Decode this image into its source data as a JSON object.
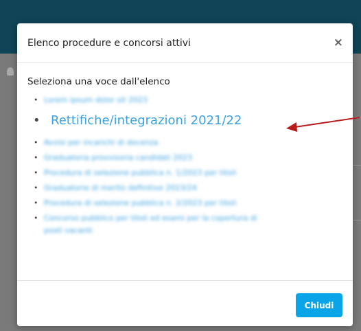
{
  "modal": {
    "title": "Elenco procedure e concorsi attivi",
    "close_glyph": "×",
    "instruction": "Seleziona una voce dall'elenco",
    "items": [
      {
        "label": "Lorem ipsum dolor sit 2023",
        "highlight": false
      },
      {
        "label": "Rettifiche/integrazioni 2021/22",
        "highlight": true
      },
      {
        "label": "Avvisi per incarichi di docenza",
        "highlight": false
      },
      {
        "label": "Graduatoria provvisoria candidati 2023",
        "highlight": false
      },
      {
        "label": "Procedura di selezione pubblica n. 1/2023 per titoli",
        "highlight": false
      },
      {
        "label": "Graduatorie di merito definitive 2023/24",
        "highlight": false
      },
      {
        "label": "Procedura di selezione pubblica n. 2/2023 per titoli",
        "highlight": false
      },
      {
        "label": "Concorso pubblico per titoli ed esami per la copertura di",
        "highlight": false
      },
      {
        "label": "posti vacanti",
        "highlight": false
      }
    ],
    "close_button_label": "Chiudi"
  },
  "colors": {
    "topbar": "#0f4556",
    "link": "#3aa2e0",
    "button": "#0aa5e8",
    "arrow": "#b71c1c"
  }
}
